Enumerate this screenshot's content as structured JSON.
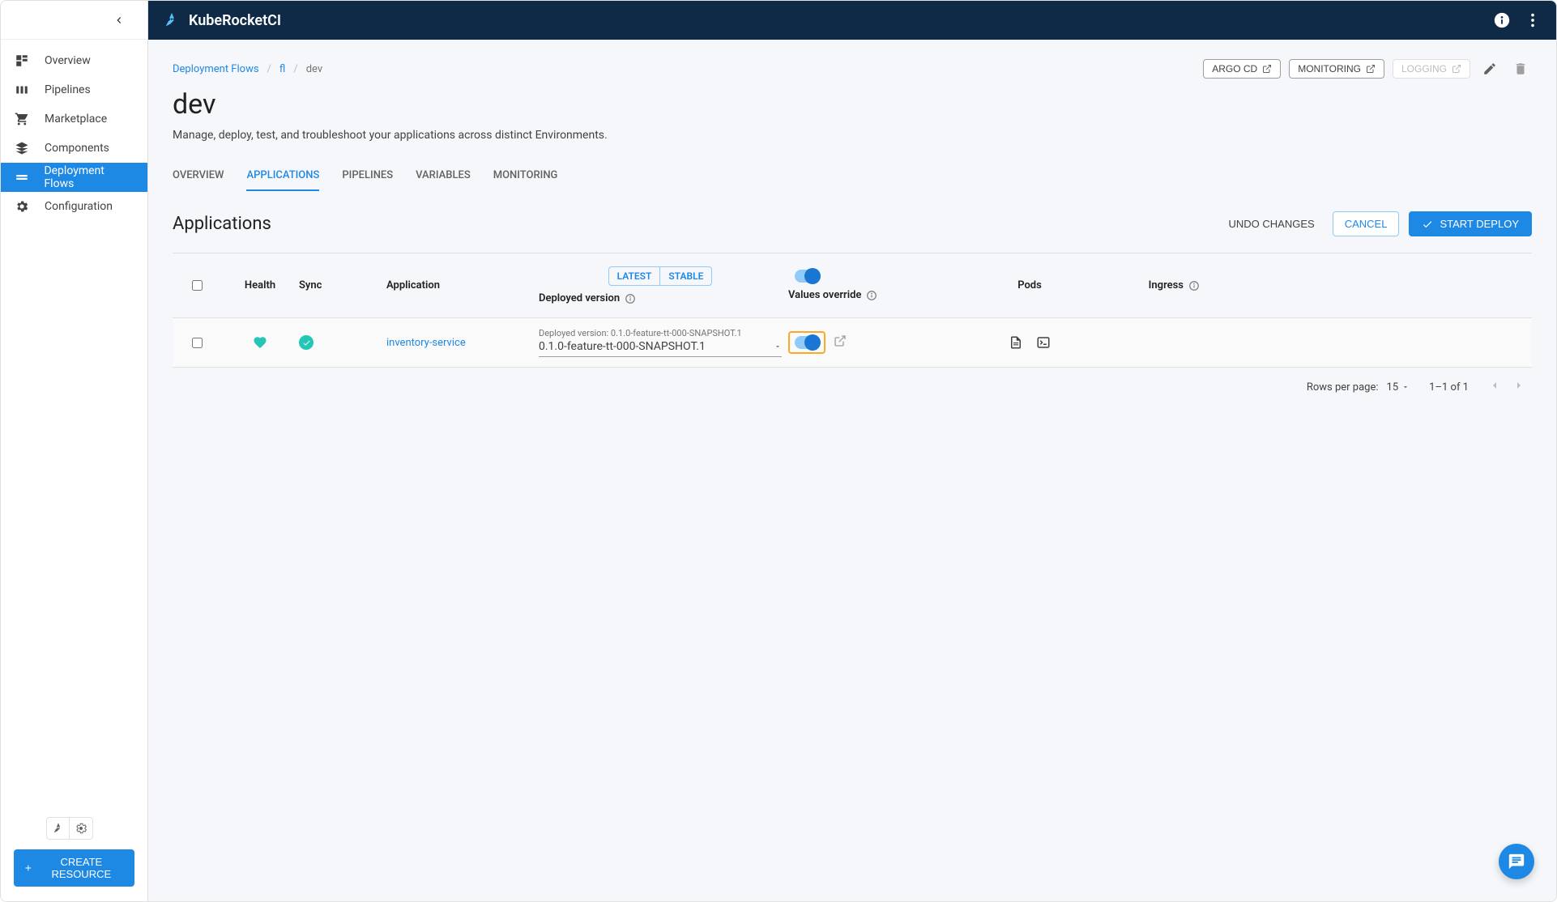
{
  "brand": "KubeRocketCI",
  "sidebar": {
    "items": [
      {
        "label": "Overview"
      },
      {
        "label": "Pipelines"
      },
      {
        "label": "Marketplace"
      },
      {
        "label": "Components"
      },
      {
        "label": "Deployment Flows"
      },
      {
        "label": "Configuration"
      }
    ],
    "create_resource": "CREATE RESOURCE"
  },
  "breadcrumb": {
    "root": "Deployment Flows",
    "flow": "fl",
    "env": "dev"
  },
  "page": {
    "title": "dev",
    "description": "Manage, deploy, test, and troubleshoot your applications across distinct Environments."
  },
  "page_actions": {
    "argocd": "ARGO CD",
    "monitoring": "MONITORING",
    "logging": "LOGGING"
  },
  "tabs": [
    {
      "label": "OVERVIEW"
    },
    {
      "label": "APPLICATIONS"
    },
    {
      "label": "PIPELINES"
    },
    {
      "label": "VARIABLES"
    },
    {
      "label": "MONITORING"
    }
  ],
  "section": {
    "title": "Applications",
    "undo": "UNDO CHANGES",
    "cancel": "CANCEL",
    "start_deploy": "START DEPLOY"
  },
  "table": {
    "headers": {
      "health": "Health",
      "sync": "Sync",
      "application": "Application",
      "deployed_version": "Deployed version",
      "values_override": "Values override",
      "pods": "Pods",
      "ingress": "Ingress"
    },
    "pills": {
      "latest": "LATEST",
      "stable": "STABLE"
    },
    "rows": [
      {
        "application": "inventory-service",
        "version_label": "Deployed version: 0.1.0-feature-tt-000-SNAPSHOT.1",
        "version_value": "0.1.0-feature-tt-000-SNAPSHOT.1"
      }
    ]
  },
  "pagination": {
    "rows_label": "Rows per page:",
    "rows_value": "15",
    "range": "1–1 of 1"
  }
}
